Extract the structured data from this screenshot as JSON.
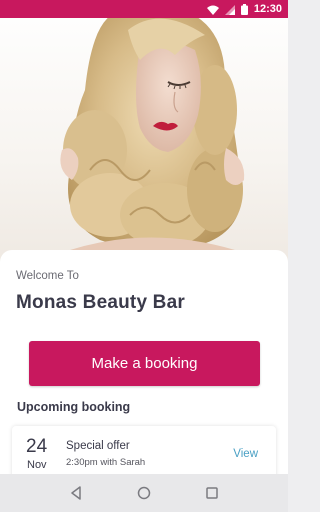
{
  "status_bar": {
    "time": "12:30",
    "icons": [
      "wifi-icon",
      "signal-icon",
      "battery-icon"
    ],
    "color": "#c8185e"
  },
  "hero": {
    "icon": "hero-photo"
  },
  "welcome": {
    "greeting": "Welcome To",
    "salon_name": "Monas Beauty Bar"
  },
  "actions": {
    "book_label": "Make a booking",
    "accent": "#c8185e"
  },
  "upcoming": {
    "title": "Upcoming booking",
    "booking": {
      "day": "24",
      "month": "Nov",
      "title": "Special offer",
      "subtitle": "2:30pm with Sarah",
      "action": "View"
    }
  },
  "nav": {
    "icons": [
      "back-icon",
      "home-icon",
      "recents-icon"
    ]
  }
}
